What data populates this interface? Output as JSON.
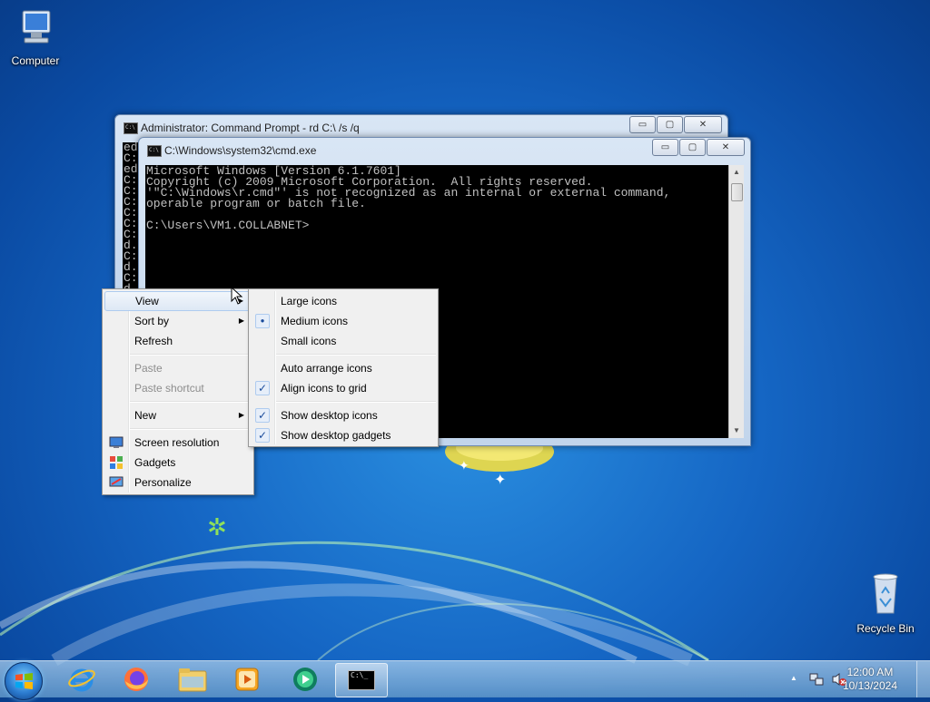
{
  "desktop": {
    "computer_label": "Computer",
    "recycle_label": "Recycle Bin"
  },
  "back_window": {
    "title": "Administrator:  Command Prompt - rd  C:\\ /s /q",
    "buttons": {
      "minimize": "▭",
      "maximize": "▢",
      "close": "✕"
    },
    "console_lines": [
      "ed",
      "C:",
      "ed",
      "C:",
      "C:",
      "C:",
      "C:",
      "C:",
      "C:",
      "d.",
      "C:",
      "d.",
      "C:",
      "d."
    ]
  },
  "front_window": {
    "title": "C:\\Windows\\system32\\cmd.exe",
    "buttons": {
      "minimize": "▭",
      "maximize": "▢",
      "close": "✕"
    },
    "console_text": "Microsoft Windows [Version 6.1.7601]\nCopyright (c) 2009 Microsoft Corporation.  All rights reserved.\n'\"C:\\Windows\\r.cmd\"' is not recognized as an internal or external command,\noperable program or batch file.\n\nC:\\Users\\VM1.COLLABNET>"
  },
  "context_menu": {
    "items": [
      {
        "label": "View",
        "submenu": true
      },
      {
        "label": "Sort by",
        "submenu": true
      },
      {
        "label": "Refresh"
      },
      {
        "label": "Paste",
        "disabled": true
      },
      {
        "label": "Paste shortcut",
        "disabled": true
      },
      {
        "label": "New",
        "submenu": true
      },
      {
        "label": "Screen resolution",
        "icon": "monitor-icon"
      },
      {
        "label": "Gadgets",
        "icon": "gadgets-icon"
      },
      {
        "label": "Personalize",
        "icon": "personalize-icon"
      }
    ],
    "arrow_glyph": "▶"
  },
  "view_submenu": {
    "items": [
      {
        "label": "Large icons"
      },
      {
        "label": "Medium icons",
        "mark": "●"
      },
      {
        "label": "Small icons"
      },
      {
        "label": "Auto arrange icons"
      },
      {
        "label": "Align icons to grid",
        "mark": "✓"
      },
      {
        "label": "Show desktop icons",
        "mark": "✓"
      },
      {
        "label": "Show desktop gadgets",
        "mark": "✓"
      }
    ]
  },
  "taskbar": {
    "apps": [
      "internet-explorer-icon",
      "firefox-icon",
      "file-explorer-icon",
      "media-player-icon",
      "media-center-icon",
      "command-prompt-icon"
    ],
    "cmd_glyph": "C:\\_",
    "tray_arrow": "▲",
    "clock_time": "12:00 AM",
    "clock_date": "10/13/2024"
  }
}
